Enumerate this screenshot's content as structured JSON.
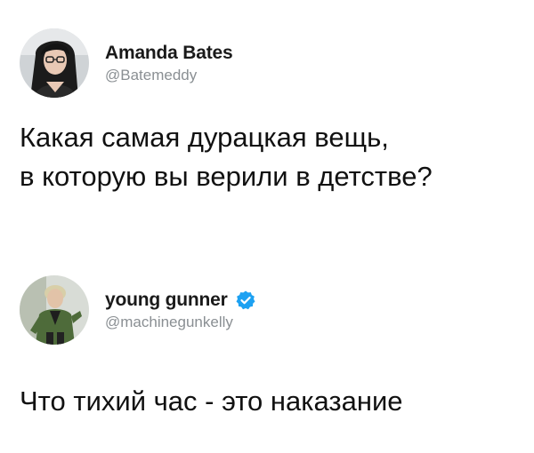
{
  "tweets": [
    {
      "author": {
        "display_name": "Amanda Bates",
        "handle": "@Batemeddy",
        "avatar_icon": "avatar-dark-hair-woman",
        "verified": false
      },
      "text": "Какая самая дурацкая вещь,\nв которую вы верили в детстве?"
    },
    {
      "author": {
        "display_name": "young gunner",
        "handle": "@machinegunkelly",
        "avatar_icon": "avatar-man-green-jacket",
        "verified": true,
        "verified_icon": "verified-badge-icon",
        "verified_color": "#1da1f2"
      },
      "text": "Что тихий час - это наказание"
    }
  ]
}
